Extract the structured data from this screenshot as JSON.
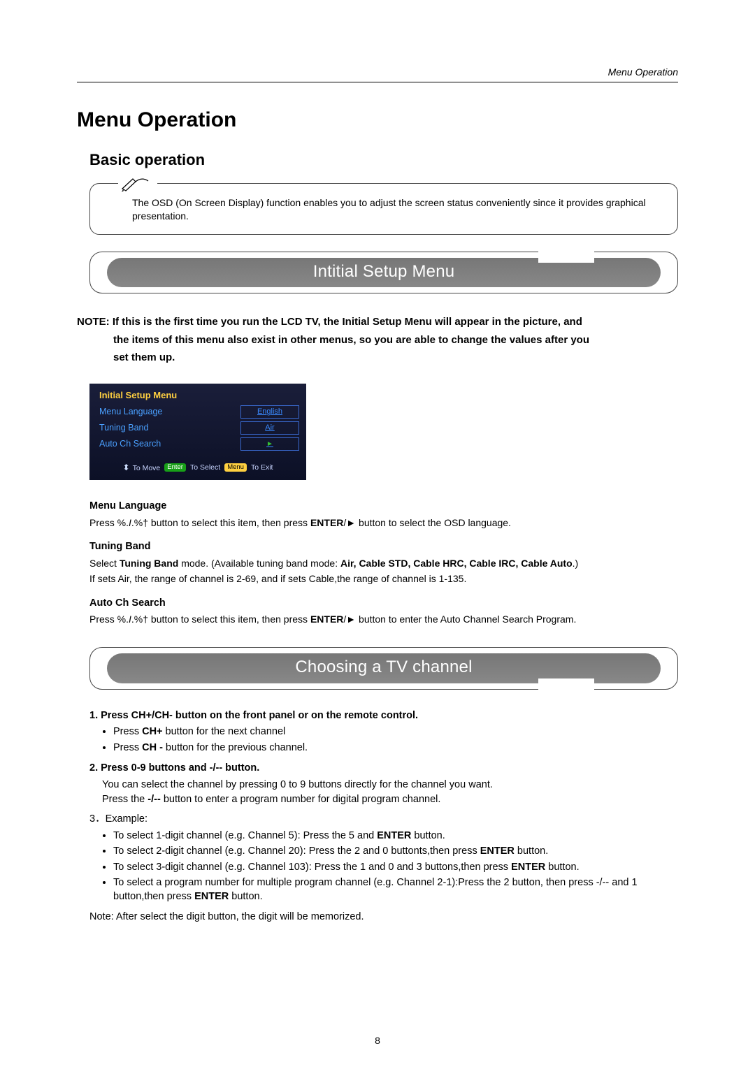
{
  "header": {
    "right": "Menu Operation"
  },
  "title": "Menu Operation",
  "subtitle": "Basic operation",
  "callout": {
    "text": "The OSD (On Screen Display) function enables you to adjust the screen status conveniently since it provides graphical presentation."
  },
  "banner1": "Intitial Setup Menu",
  "note": {
    "prefix": "NOTE:",
    "line1": "If this is the first time you run the LCD TV, the Initial Setup Menu will appear in the picture, and",
    "line2": "the items of this menu also exist in other menus, so you are able to change the values after you",
    "line3": "set them up."
  },
  "osd": {
    "title": "Initial Setup Menu",
    "rows": [
      {
        "label": "Menu Language",
        "value": "English"
      },
      {
        "label": "Tuning Band",
        "value": "Air"
      },
      {
        "label": "Auto Ch Search",
        "value": ""
      }
    ],
    "footer": {
      "move": "To Move",
      "enter": "Enter",
      "select": "To Select",
      "menu": "Menu",
      "exit": "To Exit"
    }
  },
  "sections": {
    "menuLanguage": {
      "title": "Menu Language",
      "body_pre": "Press %.",
      "body_mid": "I",
      "body_post": ".%† button to select this item, then press ",
      "enter": "ENTER",
      "body_tail": "/► button to select the OSD language."
    },
    "tuningBand": {
      "title": "Tuning Band",
      "line1_pre": "Select ",
      "line1_bold": "Tuning Band",
      "line1_mid": " mode. (Available tuning band mode: ",
      "line1_modes": "Air, Cable STD, Cable HRC, Cable IRC, Cable Auto",
      "line1_end": ".)",
      "line2": "If sets Air, the range of channel is 2-69, and if sets Cable,the range of channel is 1-135."
    },
    "autoCh": {
      "title": "Auto Ch Search",
      "body_pre": "Press %.",
      "body_mid": "I",
      "body_post": ".%† button to select this item, then press ",
      "enter": "ENTER",
      "body_tail": "/► button to enter the Auto Channel Search Program."
    }
  },
  "banner2": "Choosing a TV channel",
  "choosing": {
    "n1": "1. Press CH+/CH- button on the front panel or on the remote control.",
    "b1a_pre": "Press ",
    "b1a_bold": "CH+",
    "b1a_post": " button for the next channel",
    "b1b_pre": "Press ",
    "b1b_bold": "CH -",
    "b1b_post": " button for the previous channel.",
    "n2": "2. Press 0-9 buttons and -/-- button.",
    "n2a": "You can select the channel by pressing 0 to 9 buttons directly for the channel you want.",
    "n2b_pre": "Press the  ",
    "n2b_bold": "-/--",
    "n2b_post": " button to enter a program number for digital program channel.",
    "n3": "3．Example:",
    "ex1_pre": "To select 1-digit channel (e.g. Channel 5): Press the 5 and ",
    "ex1_bold": "ENTER",
    "ex1_post": " button.",
    "ex2_pre": "To select 2-digit channel (e.g. Channel 20): Press the 2 and 0 buttonts,then press ",
    "ex2_bold": "ENTER",
    "ex2_post": " button.",
    "ex3_pre": "To select 3-digit channel (e.g. Channel 103): Press the 1 and 0 and 3 buttons,then press ",
    "ex3_bold": "ENTER",
    "ex3_post": " button.",
    "ex4_pre": "To select a program number for multiple program channel (e.g. Channel 2-1):Press the 2 button, then press -/-- and 1 button,then press ",
    "ex4_bold": "ENTER",
    "ex4_post": " button.",
    "final": "Note: After select the digit button, the digit will be memorized."
  },
  "pageNumber": "8"
}
